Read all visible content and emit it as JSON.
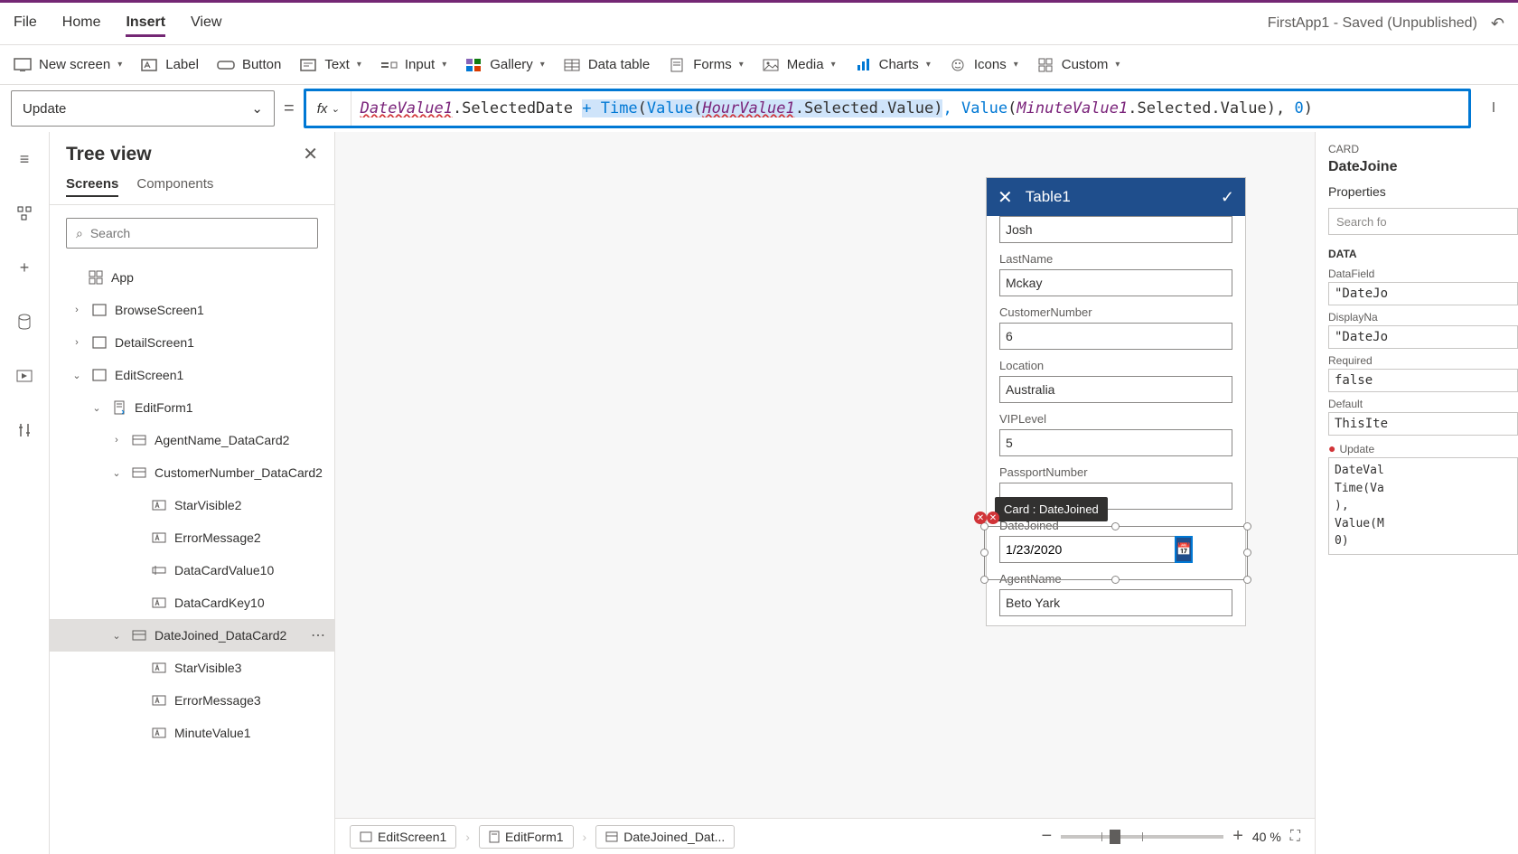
{
  "app_title": "FirstApp1 - Saved (Unpublished)",
  "menubar": [
    "File",
    "Home",
    "Insert",
    "View"
  ],
  "active_menu": "Insert",
  "ribbon": {
    "new_screen": "New screen",
    "label": "Label",
    "button": "Button",
    "text": "Text",
    "input": "Input",
    "gallery": "Gallery",
    "data_table": "Data table",
    "forms": "Forms",
    "media": "Media",
    "charts": "Charts",
    "icons": "Icons",
    "custom": "Custom"
  },
  "property_selector": "Update",
  "formula": {
    "p1": "DateValue1",
    "p2": ".SelectedDate ",
    "p3": "+ ",
    "p4": "Time",
    "p5": "(",
    "p6": "Value",
    "p7": "(",
    "p8": "HourValue1",
    "p9": ".Selected.Value)",
    "p10": ", ",
    "p11": "Value",
    "p12": "(",
    "p13": "MinuteValue1",
    "p14": ".Selected.Value), ",
    "p15": "0",
    "p16": ")"
  },
  "tree": {
    "title": "Tree view",
    "tabs": [
      "Screens",
      "Components"
    ],
    "active_tab": "Screens",
    "search_placeholder": "Search",
    "app_node": "App",
    "nodes": [
      {
        "label": "BrowseScreen1",
        "indent": 1,
        "expand": ">",
        "icon": "screen"
      },
      {
        "label": "DetailScreen1",
        "indent": 1,
        "expand": ">",
        "icon": "screen"
      },
      {
        "label": "EditScreen1",
        "indent": 1,
        "expand": "v",
        "icon": "screen"
      },
      {
        "label": "EditForm1",
        "indent": 2,
        "expand": "v",
        "icon": "form"
      },
      {
        "label": "AgentName_DataCard2",
        "indent": 3,
        "expand": ">",
        "icon": "card"
      },
      {
        "label": "CustomerNumber_DataCard2",
        "indent": 3,
        "expand": "v",
        "icon": "card"
      },
      {
        "label": "StarVisible2",
        "indent": 4,
        "expand": "",
        "icon": "label"
      },
      {
        "label": "ErrorMessage2",
        "indent": 4,
        "expand": "",
        "icon": "label"
      },
      {
        "label": "DataCardValue10",
        "indent": 4,
        "expand": "",
        "icon": "input"
      },
      {
        "label": "DataCardKey10",
        "indent": 4,
        "expand": "",
        "icon": "label"
      },
      {
        "label": "DateJoined_DataCard2",
        "indent": 3,
        "expand": "v",
        "icon": "card",
        "sel": true
      },
      {
        "label": "StarVisible3",
        "indent": 4,
        "expand": "",
        "icon": "label"
      },
      {
        "label": "ErrorMessage3",
        "indent": 4,
        "expand": "",
        "icon": "label"
      },
      {
        "label": "MinuteValue1",
        "indent": 4,
        "expand": "",
        "icon": "label"
      }
    ]
  },
  "phone": {
    "title": "Table1",
    "fields": {
      "firstname_val": "Josh",
      "lastname_lbl": "LastName",
      "lastname_val": "Mckay",
      "custnum_lbl": "CustomerNumber",
      "custnum_val": "6",
      "location_lbl": "Location",
      "location_val": "Australia",
      "vip_lbl": "VIPLevel",
      "vip_val": "5",
      "passport_lbl": "PassportNumber",
      "passport_val": "",
      "datejoined_lbl": "DateJoined",
      "datejoined_val": "1/23/2020",
      "agent_lbl": "AgentName",
      "agent_val": "Beto Yark"
    },
    "tooltip": "Card : DateJoined"
  },
  "breadcrumbs": [
    "EditScreen1",
    "EditForm1",
    "DateJoined_Dat..."
  ],
  "zoom": {
    "value": "40",
    "unit": "%"
  },
  "props": {
    "card_label": "CARD",
    "card_name": "DateJoine",
    "tab": "Properties",
    "search_ph": "Search fo",
    "section": "DATA",
    "rows": [
      {
        "lbl": "DataField",
        "val": "\"DateJo"
      },
      {
        "lbl": "DisplayNa",
        "val": "\"DateJo"
      },
      {
        "lbl": "Required",
        "val": "false"
      },
      {
        "lbl": "Default",
        "val": "ThisIte"
      }
    ],
    "update_lbl": "Update",
    "update_code": [
      "DateVal",
      "Time(Va",
      "),",
      "Value(M",
      "0)"
    ]
  }
}
